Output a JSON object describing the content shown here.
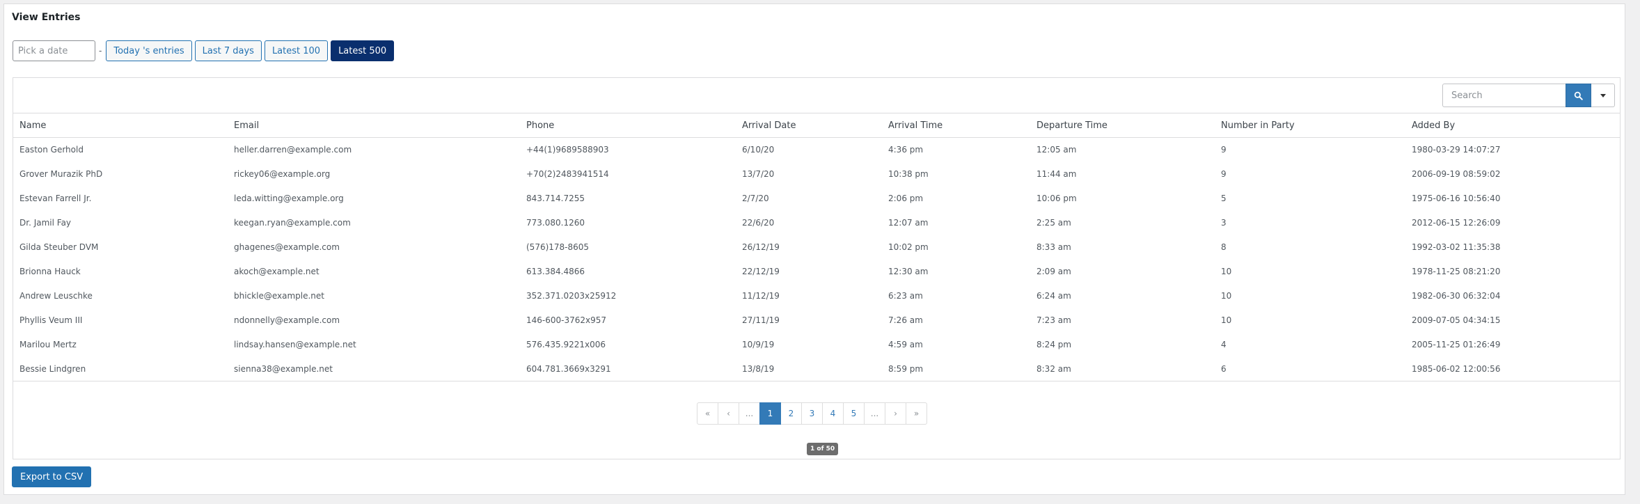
{
  "page": {
    "title": "View Entries"
  },
  "filters": {
    "date_placeholder": "Pick a date",
    "separator": "-",
    "buttons": [
      "Today 's entries",
      "Last 7 days",
      "Latest 100",
      "Latest 500"
    ],
    "active": "Latest 500"
  },
  "search": {
    "placeholder": "Search",
    "button_icon": "search-icon",
    "dropdown_icon": "caret-down-icon"
  },
  "table": {
    "columns": [
      "Name",
      "Email",
      "Phone",
      "Arrival Date",
      "Arrival Time",
      "Departure Time",
      "Number in Party",
      "Added By"
    ],
    "rows": [
      [
        "Easton Gerhold",
        "heller.darren@example.com",
        "+44(1)9689588903",
        "6/10/20",
        "4:36 pm",
        "12:05 am",
        "9",
        "1980-03-29 14:07:27"
      ],
      [
        "Grover Murazik PhD",
        "rickey06@example.org",
        "+70(2)2483941514",
        "13/7/20",
        "10:38 pm",
        "11:44 am",
        "9",
        "2006-09-19 08:59:02"
      ],
      [
        "Estevan Farrell Jr.",
        "leda.witting@example.org",
        "843.714.7255",
        "2/7/20",
        "2:06 pm",
        "10:06 pm",
        "5",
        "1975-06-16 10:56:40"
      ],
      [
        "Dr. Jamil Fay",
        "keegan.ryan@example.com",
        "773.080.1260",
        "22/6/20",
        "12:07 am",
        "2:25 am",
        "3",
        "2012-06-15 12:26:09"
      ],
      [
        "Gilda Steuber DVM",
        "ghagenes@example.com",
        "(576)178-8605",
        "26/12/19",
        "10:02 pm",
        "8:33 am",
        "8",
        "1992-03-02 11:35:38"
      ],
      [
        "Brionna Hauck",
        "akoch@example.net",
        "613.384.4866",
        "22/12/19",
        "12:30 am",
        "2:09 am",
        "10",
        "1978-11-25 08:21:20"
      ],
      [
        "Andrew Leuschke",
        "bhickle@example.net",
        "352.371.0203x25912",
        "11/12/19",
        "6:23 am",
        "6:24 am",
        "10",
        "1982-06-30 06:32:04"
      ],
      [
        "Phyllis Veum III",
        "ndonnelly@example.com",
        "146-600-3762x957",
        "27/11/19",
        "7:26 am",
        "7:23 am",
        "10",
        "2009-07-05 04:34:15"
      ],
      [
        "Marilou Mertz",
        "lindsay.hansen@example.net",
        "576.435.9221x006",
        "10/9/19",
        "4:59 am",
        "8:24 pm",
        "4",
        "2005-11-25 01:26:49"
      ],
      [
        "Bessie Lindgren",
        "sienna38@example.net",
        "604.781.3669x3291",
        "13/8/19",
        "8:59 pm",
        "8:32 am",
        "6",
        "1985-06-02 12:00:56"
      ]
    ]
  },
  "pagination": {
    "items": [
      "«",
      "‹",
      "...",
      "1",
      "2",
      "3",
      "4",
      "5",
      "...",
      "›",
      "»"
    ],
    "current": "1",
    "summary": "1 of 50"
  },
  "export": {
    "label": "Export to CSV"
  },
  "colors": {
    "accent": "#2271b1",
    "active_filter": "#0a2f6e",
    "page_current": "#337ab7",
    "badge": "#6d6d6d"
  }
}
